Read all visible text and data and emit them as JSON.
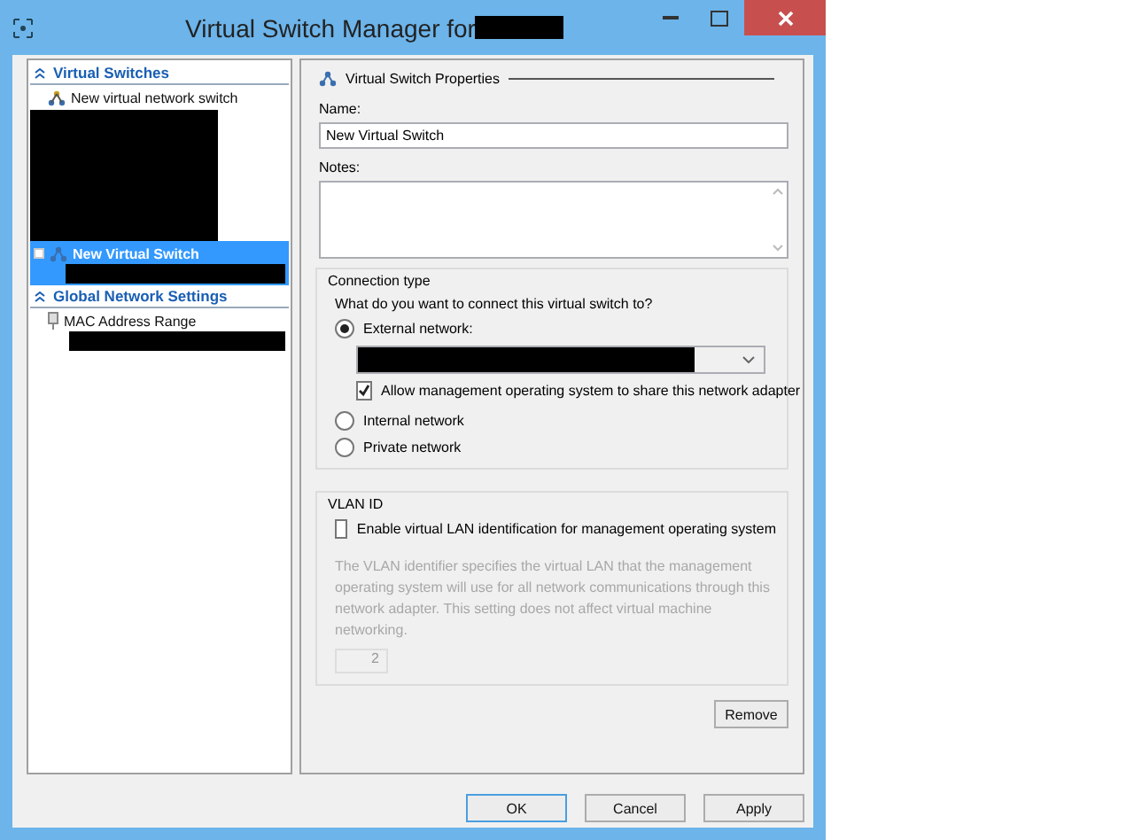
{
  "window": {
    "title": "Virtual Switch Manager for"
  },
  "tree": [
    {
      "title": "Virtual Switches",
      "expanded": true,
      "items": [
        {
          "label": "New virtual network switch",
          "kind": "action",
          "selected": false
        },
        {
          "label": "New Virtual Switch",
          "kind": "switch",
          "selected": true
        }
      ]
    },
    {
      "title": "Global Network Settings",
      "expanded": true,
      "items": [
        {
          "label": "MAC Address Range",
          "kind": "setting",
          "selected": false
        }
      ]
    }
  ],
  "properties": {
    "title": "Virtual Switch Properties",
    "name_label": "Name:",
    "name_value": "New Virtual Switch",
    "notes_label": "Notes:",
    "connection": {
      "title": "Connection type",
      "question": "What do you want to connect this virtual switch to?",
      "options": [
        {
          "label": "External network:",
          "selected": true,
          "kind": "external"
        },
        {
          "label": "Internal network",
          "selected": false,
          "kind": "plain"
        },
        {
          "label": "Private network",
          "selected": false,
          "kind": "plain"
        }
      ],
      "share_label": "Allow management operating system to share this network adapter",
      "share_checked": true
    },
    "vlan": {
      "title": "VLAN ID",
      "enable_label": "Enable virtual LAN identification for management operating system",
      "enable_checked": false,
      "description": "The VLAN identifier specifies the virtual LAN that the management operating system will use for all network communications through this network adapter. This setting does not affect virtual machine networking.",
      "value": "2"
    },
    "remove": "Remove"
  },
  "buttons": [
    {
      "label": "OK",
      "default": true
    },
    {
      "label": "Cancel",
      "default": false
    },
    {
      "label": "Apply",
      "default": false
    }
  ]
}
